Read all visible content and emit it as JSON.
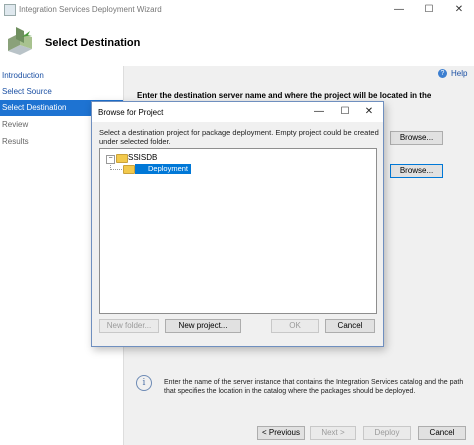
{
  "window": {
    "title": "Integration Services Deployment Wizard",
    "minimize_glyph": "—",
    "maximize_glyph": "☐",
    "close_glyph": "✕"
  },
  "header": {
    "page_title": "Select Destination",
    "icon": "wizard-icon"
  },
  "nav": {
    "items": [
      {
        "label": "Introduction",
        "state": "link"
      },
      {
        "label": "Select Source",
        "state": "link"
      },
      {
        "label": "Select Destination",
        "state": "selected"
      },
      {
        "label": "Review",
        "state": "disabled"
      },
      {
        "label": "Results",
        "state": "disabled"
      }
    ]
  },
  "help": {
    "label": "Help",
    "icon_glyph": "?"
  },
  "content": {
    "prompt": "Enter the destination server name and where the project will be located in the",
    "browse_label_1": "Browse...",
    "browse_label_2": "Browse...",
    "info_glyph": "i",
    "info_text": "Enter the name of the server instance that contains the Integration Services catalog and the path that specifies the location in the catalog where the packages should be deployed."
  },
  "footer": {
    "previous": "< Previous",
    "next": "Next >",
    "deploy": "Deploy",
    "cancel": "Cancel"
  },
  "dialog": {
    "title": "Browse for Project",
    "minimize_glyph": "—",
    "maximize_glyph": "☐",
    "close_glyph": "✕",
    "description": "Select a destination project for package deployment. Empty project could be created under selected folder.",
    "tree": {
      "expander_glyph": "−",
      "root": "SSISDB",
      "child": "Deployment"
    },
    "buttons": {
      "new_folder": "New folder...",
      "new_project": "New project...",
      "ok": "OK",
      "cancel": "Cancel"
    }
  }
}
